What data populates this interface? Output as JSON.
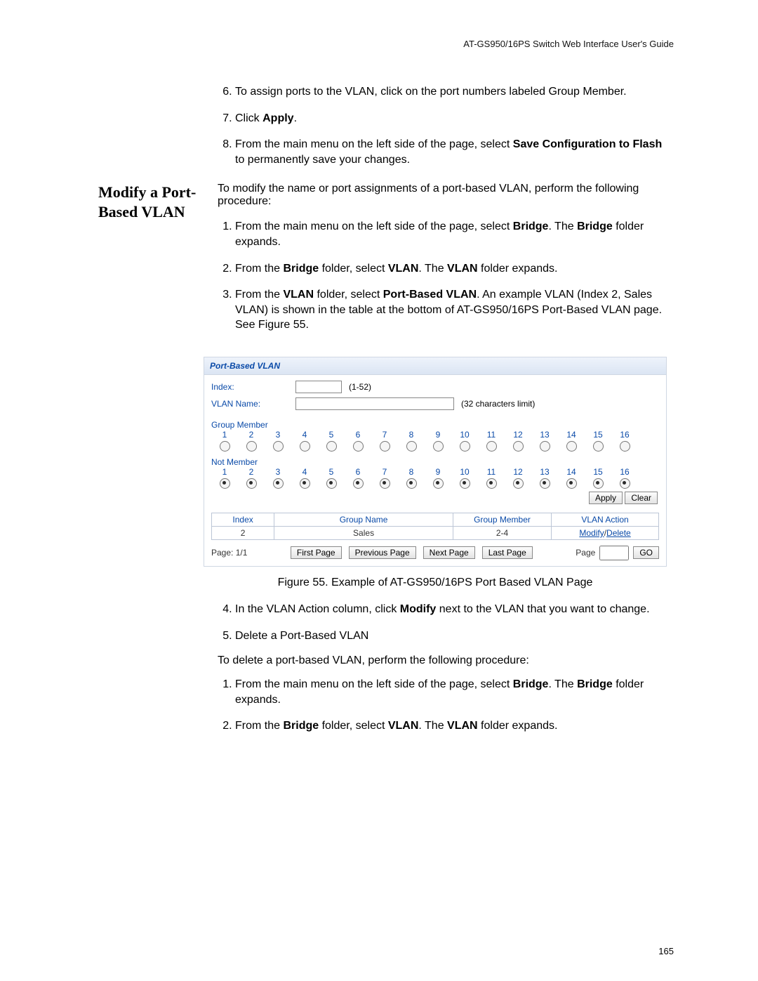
{
  "header": {
    "guide_title": "AT-GS950/16PS Switch Web Interface User's Guide"
  },
  "top_steps": {
    "start": 6,
    "items": [
      "To assign ports to the VLAN, click on the port numbers labeled Group Member.",
      "Click Apply.",
      "From the main menu on the left side of the page, select Save Configuration to Flash to permanently save your changes."
    ]
  },
  "section": {
    "heading": "Modify a Port-Based VLAN",
    "intro": "To modify the name or port assignments of a port-based VLAN, perform the following procedure:",
    "steps": [
      "From the main menu on the left side of the page, select Bridge. The Bridge folder expands.",
      "From the Bridge folder, select VLAN. The VLAN folder expands.",
      "From the VLAN folder, select Port-Based VLAN. An example VLAN (Index 2, Sales VLAN) is shown in the table at the bottom of AT-GS950/16PS Port-Based VLAN page. See Figure 55."
    ]
  },
  "figure": {
    "caption": "Figure 55. Example of AT-GS950/16PS Port Based VLAN Page",
    "panel_title": "Port-Based VLAN",
    "form": {
      "index_label": "Index:",
      "index_hint": "(1-52)",
      "name_label": "VLAN Name:",
      "name_hint": "(32 characters limit)",
      "index_value": "",
      "name_value": ""
    },
    "group_member_label": "Group Member",
    "not_member_label": "Not Member",
    "ports": [
      "1",
      "2",
      "3",
      "4",
      "5",
      "6",
      "7",
      "8",
      "9",
      "10",
      "11",
      "12",
      "13",
      "14",
      "15",
      "16"
    ],
    "buttons": {
      "apply": "Apply",
      "clear": "Clear"
    },
    "table": {
      "headers": [
        "Index",
        "Group Name",
        "Group Member",
        "VLAN Action"
      ],
      "row": {
        "index": "2",
        "name": "Sales",
        "member": "2-4",
        "action_modify": "Modify",
        "action_delete": "Delete"
      }
    },
    "pager": {
      "page_label": "Page:",
      "page_value": "1/1",
      "first": "First Page",
      "prev": "Previous Page",
      "next": "Next Page",
      "last": "Last Page",
      "go_label": "Page",
      "go": "GO",
      "go_value": ""
    }
  },
  "after_fig_steps": {
    "start": 4,
    "items": [
      "In the VLAN Action column, click Modify next to the VLAN that you want to change.",
      "Delete a Port-Based VLAN"
    ]
  },
  "delete_section": {
    "intro": "To delete a port-based VLAN, perform the following procedure:",
    "steps": [
      "From the main menu on the left side of the page, select Bridge. The Bridge folder expands.",
      "From the Bridge folder, select VLAN. The VLAN folder expands."
    ]
  },
  "page_number": "165"
}
